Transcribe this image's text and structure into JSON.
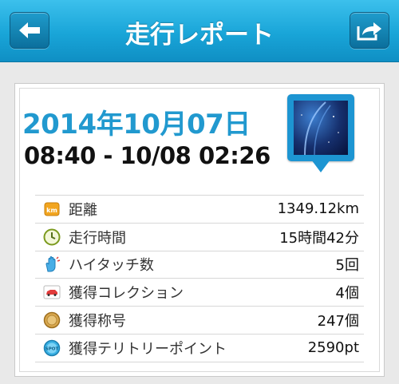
{
  "header": {
    "title": "走行レポート",
    "back_icon": "back-arrow-icon",
    "share_icon": "share-arrow-icon"
  },
  "report": {
    "date": "2014年10月07日",
    "time_range": "08:40 - 10/08 02:26"
  },
  "stats": [
    {
      "icon": "km-badge-icon",
      "label": "距離",
      "value": "1349.12km"
    },
    {
      "icon": "clock-icon",
      "label": "走行時間",
      "value": "15時間42分"
    },
    {
      "icon": "hand-icon",
      "label": "ハイタッチ数",
      "value": "5回"
    },
    {
      "icon": "car-card-icon",
      "label": "獲得コレクション",
      "value": "4個"
    },
    {
      "icon": "medal-icon",
      "label": "獲得称号",
      "value": "247個"
    },
    {
      "icon": "spot-icon",
      "label": "獲得テリトリーポイント",
      "value": "2590pt"
    }
  ],
  "colors": {
    "header": "#19a5d8",
    "date_text": "#2199cf",
    "background": "#e9e9e9"
  }
}
